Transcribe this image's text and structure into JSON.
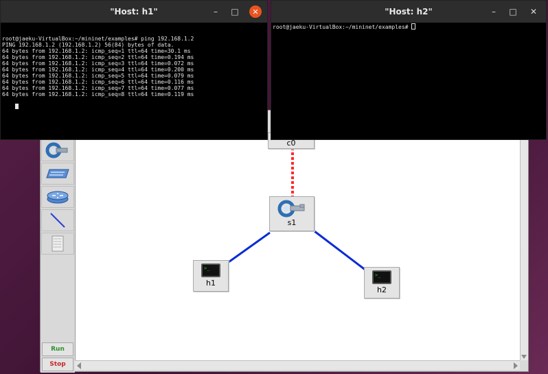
{
  "miniedit": {
    "canvas": {
      "controller": {
        "label": "c0"
      },
      "switch": {
        "label": "s1"
      },
      "hosts": [
        {
          "label": "h1"
        },
        {
          "label": "h2"
        }
      ]
    },
    "toolbox": {
      "tools": [
        {
          "icon": "controller-icon"
        },
        {
          "icon": "switch-icon"
        },
        {
          "icon": "router-icon"
        },
        {
          "icon": "link-icon"
        },
        {
          "icon": "netlink-icon"
        }
      ],
      "run_label": "Run",
      "stop_label": "Stop"
    },
    "colors": {
      "control_link": "#ff2a2a",
      "data_link": "#0b2bd6",
      "run_text": "#2f8f2f",
      "stop_text": "#c42828"
    }
  },
  "terminals": {
    "h1": {
      "title": "\"Host: h1\"",
      "lines": [
        "root@jaeku-VirtualBox:~/mininet/examples# ping 192.168.1.2",
        "PING 192.168.1.2 (192.168.1.2) 56(84) bytes of data.",
        "64 bytes from 192.168.1.2: icmp_seq=1 ttl=64 time=30.1 ms",
        "64 bytes from 192.168.1.2: icmp_seq=2 ttl=64 time=0.194 ms",
        "64 bytes from 192.168.1.2: icmp_seq=3 ttl=64 time=0.072 ms",
        "64 bytes from 192.168.1.2: icmp_seq=4 ttl=64 time=0.200 ms",
        "64 bytes from 192.168.1.2: icmp_seq=5 ttl=64 time=0.079 ms",
        "64 bytes from 192.168.1.2: icmp_seq=6 ttl=64 time=0.116 ms",
        "64 bytes from 192.168.1.2: icmp_seq=7 ttl=64 time=0.077 ms",
        "64 bytes from 192.168.1.2: icmp_seq=8 ttl=64 time=0.119 ms"
      ]
    },
    "h2": {
      "title": "\"Host: h2\"",
      "prompt": "root@jaeku-VirtualBox:~/mininet/examples# "
    },
    "buttons": {
      "minimize": "–",
      "maximize": "□",
      "close": "✕"
    }
  }
}
